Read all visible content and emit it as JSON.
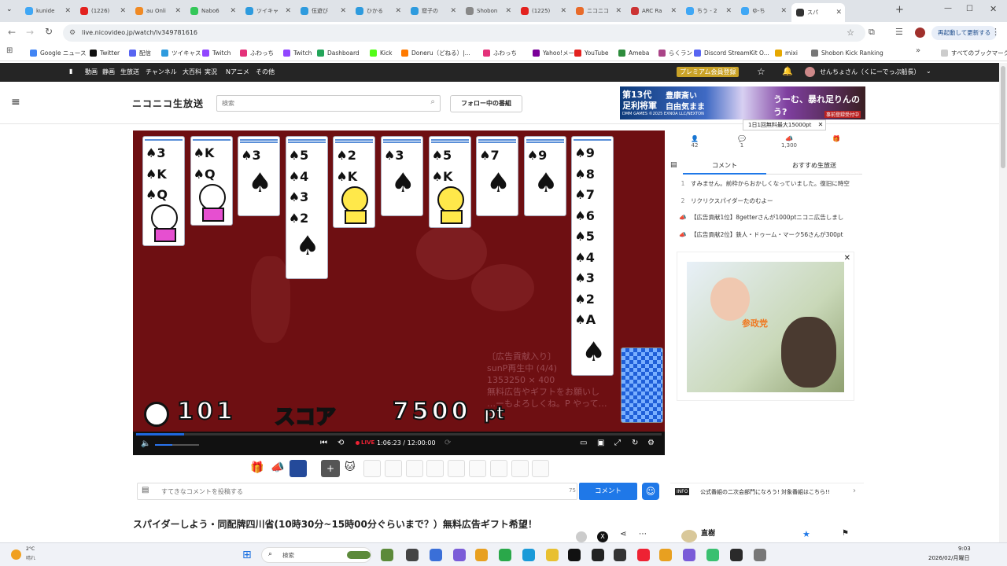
{
  "tabs": [
    {
      "label": "kunide",
      "color": "#3fa7f5"
    },
    {
      "label": "(1226)",
      "color": "#e3221f"
    },
    {
      "label": "au Onli",
      "color": "#f08a24"
    },
    {
      "label": "Nabo6",
      "color": "#34c759"
    },
    {
      "label": "ツイキャ",
      "color": "#2e9bde"
    },
    {
      "label": "伍遊び",
      "color": "#2e9bde"
    },
    {
      "label": "ひかる",
      "color": "#2e9bde"
    },
    {
      "label": "窟子の",
      "color": "#2e9bde"
    },
    {
      "label": "Shobon",
      "color": "#888888"
    },
    {
      "label": "(1225)",
      "color": "#e3221f"
    },
    {
      "label": "ニコニコ",
      "color": "#e86b2a"
    },
    {
      "label": "ARC Ra",
      "color": "#cc3333"
    },
    {
      "label": "ちう - 2",
      "color": "#3fa7f5"
    },
    {
      "label": "ゆ-ち",
      "color": "#3fa7f5"
    },
    {
      "label": "スパ",
      "color": "#333333"
    }
  ],
  "browser": {
    "url": "live.nicovideo.jp/watch/lv349781616",
    "restart_label": "再起動して更新する"
  },
  "bookmarks": [
    {
      "label": "Google ニュース",
      "color": "#4285f4"
    },
    {
      "label": "Twitter",
      "color": "#111111"
    },
    {
      "label": "配信",
      "color": "#5865f2"
    },
    {
      "label": "ツイキャス",
      "color": "#2e9bde"
    },
    {
      "label": "Twitch",
      "color": "#9146ff"
    },
    {
      "label": "ふわっち",
      "color": "#e4327a"
    },
    {
      "label": "Twitch",
      "color": "#9146ff"
    },
    {
      "label": "Dashboard",
      "color": "#23a55a"
    },
    {
      "label": "Kick",
      "color": "#53fc18"
    },
    {
      "label": "Doneru（どねる）|...",
      "color": "#ff7a00"
    },
    {
      "label": "ふわっち",
      "color": "#e4327a"
    },
    {
      "label": "Yahoo!メール",
      "color": "#7b0099"
    },
    {
      "label": "YouTube",
      "color": "#e3221f"
    },
    {
      "label": "Ameba",
      "color": "#2d8c3c"
    },
    {
      "label": "らくラン",
      "color": "#aa4488"
    },
    {
      "label": "Discord StreamKit O...",
      "color": "#5865f2"
    },
    {
      "label": "mixi",
      "color": "#e6a800"
    },
    {
      "label": "Shobon Kick Ranking",
      "color": "#777777"
    }
  ],
  "all_bookmarks_label": "すべてのブックマーク",
  "nico_nav": [
    "動画",
    "静画",
    "生放送",
    "チャンネル",
    "大百科",
    "実況",
    "Nアニメ",
    "その他"
  ],
  "nico_premium": "プレミアム会員登録",
  "nico_user": "せんちょさん（くにーでっぷ船長）",
  "header": {
    "logo": "ニコニコ生放送",
    "search_placeholder": "検索",
    "follow_button": "フォロー中の番組",
    "ad_line1": "第13代",
    "ad_line2": "足利将軍",
    "ad_line3": "豊康斎い",
    "ad_line4": "自由気まま",
    "ad_line5": "うーむ、暴れ足りんのう?",
    "ad_brand": "DMM GAMES ©2025 EXNOA LLC/NEXTON",
    "ad_tag": "事前登録受付中",
    "free_badge": "1日1回無料最大15000pt"
  },
  "game": {
    "columns": [
      {
        "ranks": [
          "3",
          "K",
          "Q"
        ]
      },
      {
        "ranks": [
          "K",
          "Q"
        ]
      },
      {
        "ranks": [
          "3"
        ]
      },
      {
        "ranks": [
          "5",
          "4",
          "3",
          "2"
        ]
      },
      {
        "ranks": [
          "2",
          "K"
        ]
      },
      {
        "ranks": [
          "3"
        ]
      },
      {
        "ranks": [
          "5",
          "K"
        ]
      },
      {
        "ranks": [
          "7"
        ]
      },
      {
        "ranks": [
          "9"
        ]
      },
      {
        "ranks": [
          "9",
          "8",
          "7",
          "6",
          "5",
          "4",
          "3",
          "2",
          "A"
        ]
      }
    ],
    "moves": "101",
    "score_label": "スコア",
    "score_value": "7500",
    "score_unit": "pt",
    "overlay_text": [
      "〔広告貢献入り〕",
      "sunP再生中 (4/4)",
      "1353250 × 400",
      "無料広告やギフトをお願いし",
      "…ーもよろしくね。P やって…"
    ]
  },
  "player": {
    "time": "1:06:23 / 12:00:00",
    "live_label": "LIVE",
    "progress": 0.092
  },
  "sidebar": {
    "stats": [
      {
        "value": "42"
      },
      {
        "value": "1"
      },
      {
        "value": "1,300"
      },
      {
        "value": ""
      }
    ],
    "tabs": [
      "コメント",
      "おすすめ生放送"
    ],
    "comments": [
      {
        "no": "1",
        "text": "すみません。前枠からおかしくなっていました。復旧に時空"
      },
      {
        "no": "2",
        "text": "リクリクスパイダーたのむよー"
      },
      {
        "no": "",
        "text": "【広告貢献1位】8getterさんが1000ptニコニ広告しまし"
      },
      {
        "no": "",
        "text": "【広告貢献2位】鉄人・ドゥーム・マーク56さんが300pt"
      }
    ],
    "ad_logo": "参政党",
    "info_badge": "INFO",
    "info_text": "公式番組の二次会部門になろう! 対象番組はこちら!!"
  },
  "comment_input": {
    "placeholder": "すてきなコメントを投稿する",
    "count": "75",
    "submit": "コメント"
  },
  "title": "スパイダーしよう・同配牌四川省(10時30分~15時00分ぐらいまで？）無料広告ギフト希望！",
  "author": "直樹",
  "taskbar": {
    "weather_temp": "2°C",
    "weather_desc": "晴れ",
    "search": "検索",
    "time": "9:03",
    "date": "2026/02/月曜日"
  }
}
